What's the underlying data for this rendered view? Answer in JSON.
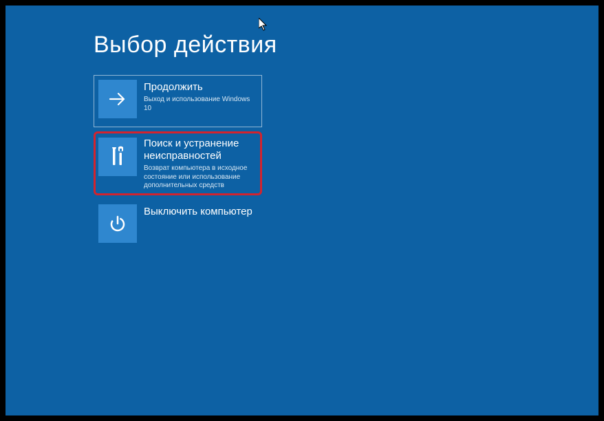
{
  "title": "Выбор действия",
  "tiles": [
    {
      "name": "continue",
      "icon": "arrow-right-icon",
      "title": "Продолжить",
      "desc": "Выход и использование Windows 10",
      "highlighted": false,
      "bordered": true
    },
    {
      "name": "troubleshoot",
      "icon": "tools-icon",
      "title": "Поиск и устранение неисправностей",
      "desc": "Возврат компьютера в исходное состояние или использование дополнительных средств",
      "highlighted": true,
      "bordered": false
    },
    {
      "name": "shutdown",
      "icon": "power-icon",
      "title": "Выключить компьютер",
      "desc": "",
      "highlighted": false,
      "bordered": false
    }
  ]
}
